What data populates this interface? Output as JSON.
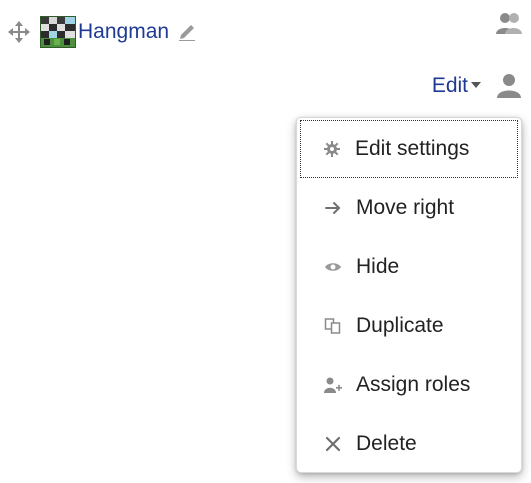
{
  "activity": {
    "name": "Hangman",
    "icons": {
      "move": "move-icon",
      "activity": "hangman-activity-icon",
      "edit_title": "pencil-icon",
      "groups": "group-icon"
    }
  },
  "edit_menu": {
    "toggle_label": "Edit",
    "toggle_icon": "caret-down-icon",
    "user_icon": "user-icon",
    "items": [
      {
        "label": "Edit settings",
        "icon": "gear-icon",
        "focused": true
      },
      {
        "label": "Move right",
        "icon": "arrow-right-icon",
        "focused": false
      },
      {
        "label": "Hide",
        "icon": "eye-icon",
        "focused": false
      },
      {
        "label": "Duplicate",
        "icon": "duplicate-icon",
        "focused": false
      },
      {
        "label": "Assign roles",
        "icon": "assign-roles-icon",
        "focused": false
      },
      {
        "label": "Delete",
        "icon": "close-icon",
        "focused": false
      }
    ]
  },
  "colors": {
    "link": "#1f3a93",
    "text": "#222222",
    "icon": "#8a8a8a"
  }
}
